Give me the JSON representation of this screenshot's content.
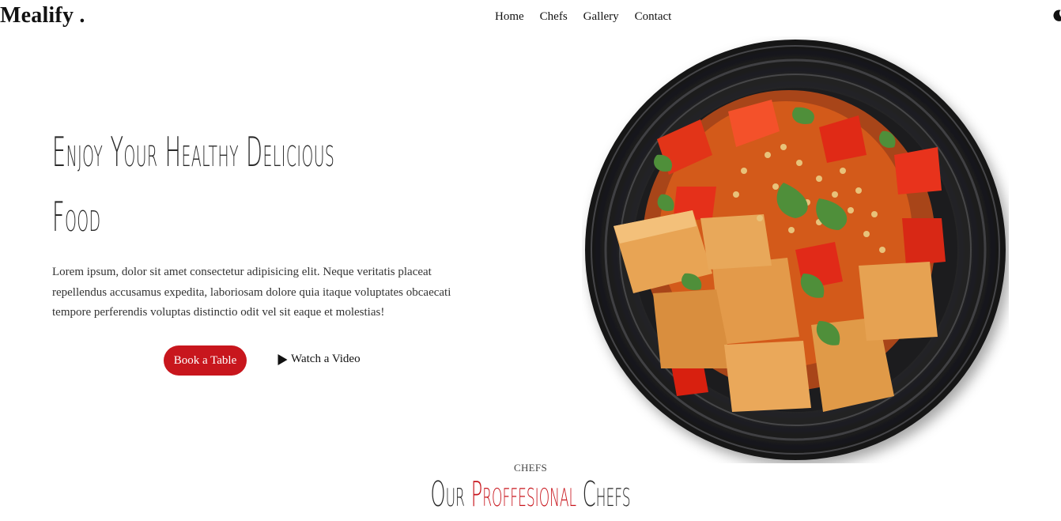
{
  "header": {
    "logo": "Mealify .",
    "nav": [
      "Home",
      "Chefs",
      "Gallery",
      "Contact"
    ],
    "theme_icon": "moon-icon"
  },
  "hero": {
    "title_line1": "Enjoy Your Healthy Delicious",
    "title_line2": "Food",
    "description": "Lorem ipsum, dolor sit amet consectetur adipisicing elit. Neque veritatis placeat repellendus accusamus expedita, laboriosam dolore quia itaque voluptates obcaecati tempore perferendis voluptas distinctio odit vel sit eaque et molestias!",
    "book_label": "Book a Table",
    "video_label": "Watch a Video",
    "image": "plate-of-fried-tofu-with-peppers"
  },
  "chefs_section": {
    "tag": "CHEFS",
    "title_part1": "Our",
    "title_accent": "Proffesional",
    "title_part2": "Chefs"
  },
  "colors": {
    "accent": "#c8161d",
    "text": "#2a2a2a",
    "background": "#ffffff"
  }
}
